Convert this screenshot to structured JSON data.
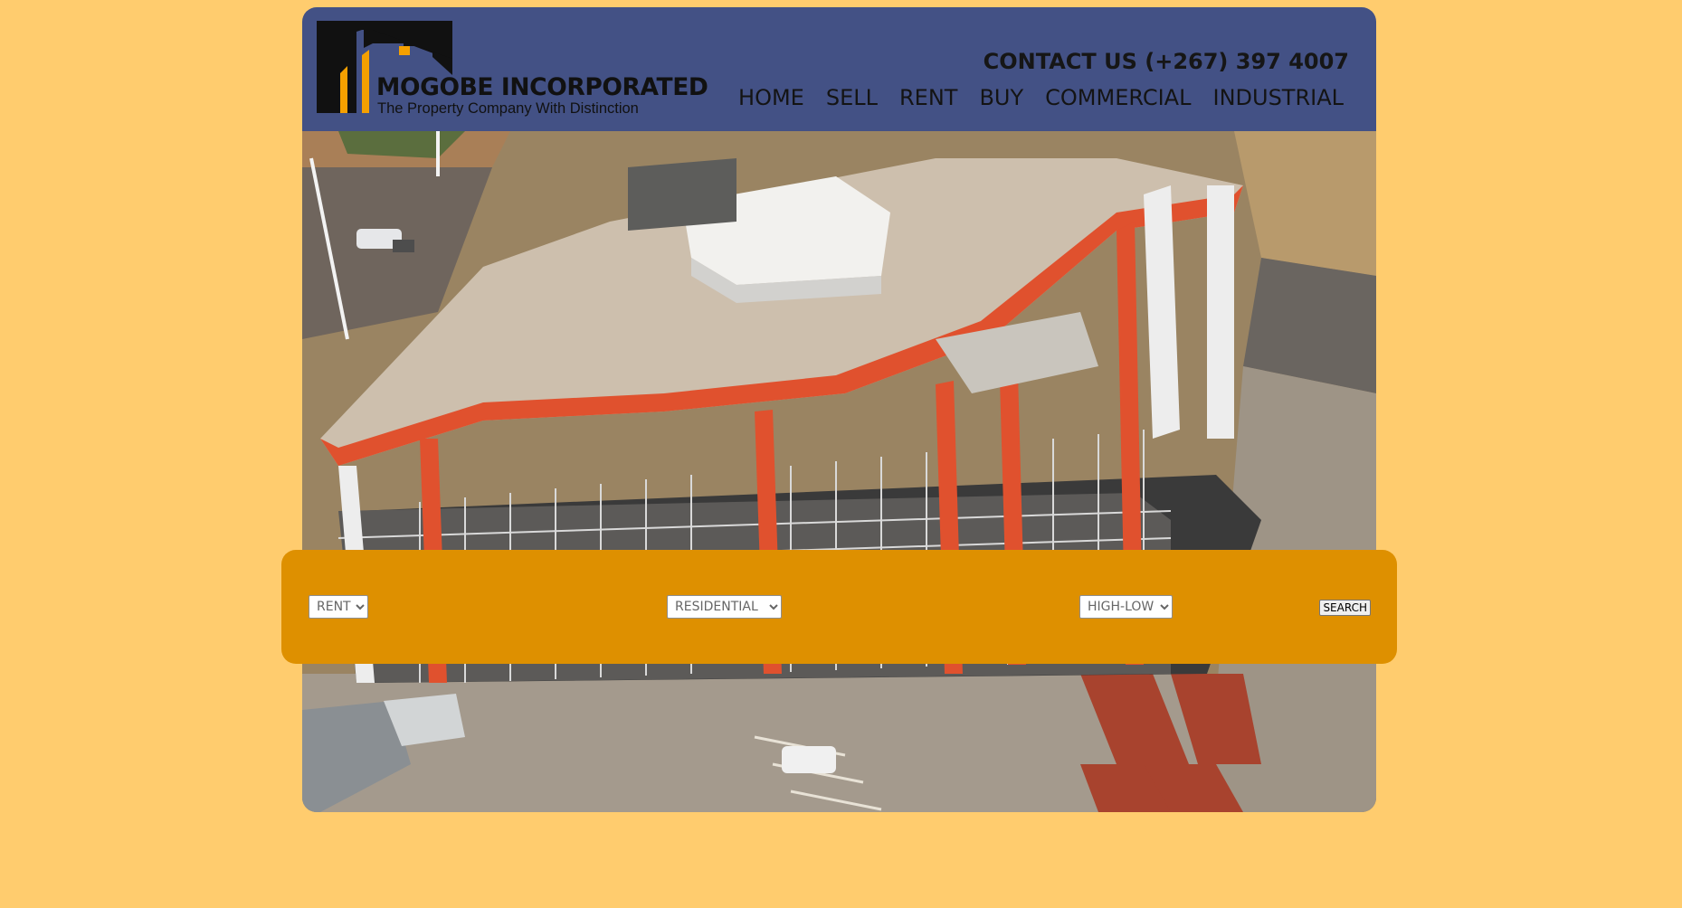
{
  "brand": {
    "name": "MOGOBE INCORPORATED",
    "tagline": "The Property Company With Distinction",
    "logo_icon": "house-roof-icon",
    "colors": {
      "header_bg": "#435185",
      "page_bg": "#ffcc6e",
      "search_bar_bg": "#de9000",
      "logo_accent": "#f5a000"
    }
  },
  "header": {
    "contact": "CONTACT US (+267) 397 4007"
  },
  "nav": {
    "items": [
      {
        "label": "HOME"
      },
      {
        "label": "SELL"
      },
      {
        "label": "RENT"
      },
      {
        "label": "BUY"
      },
      {
        "label": "COMMERCIAL"
      },
      {
        "label": "INDUSTRIAL"
      }
    ]
  },
  "hero": {
    "image": "aerial-building-photo"
  },
  "search": {
    "listing_type": {
      "selected": "RENT"
    },
    "property_category": {
      "selected": "RESIDENTIAL"
    },
    "sort_order": {
      "selected": "HIGH-LOW"
    },
    "button_label": "SEARCH"
  }
}
